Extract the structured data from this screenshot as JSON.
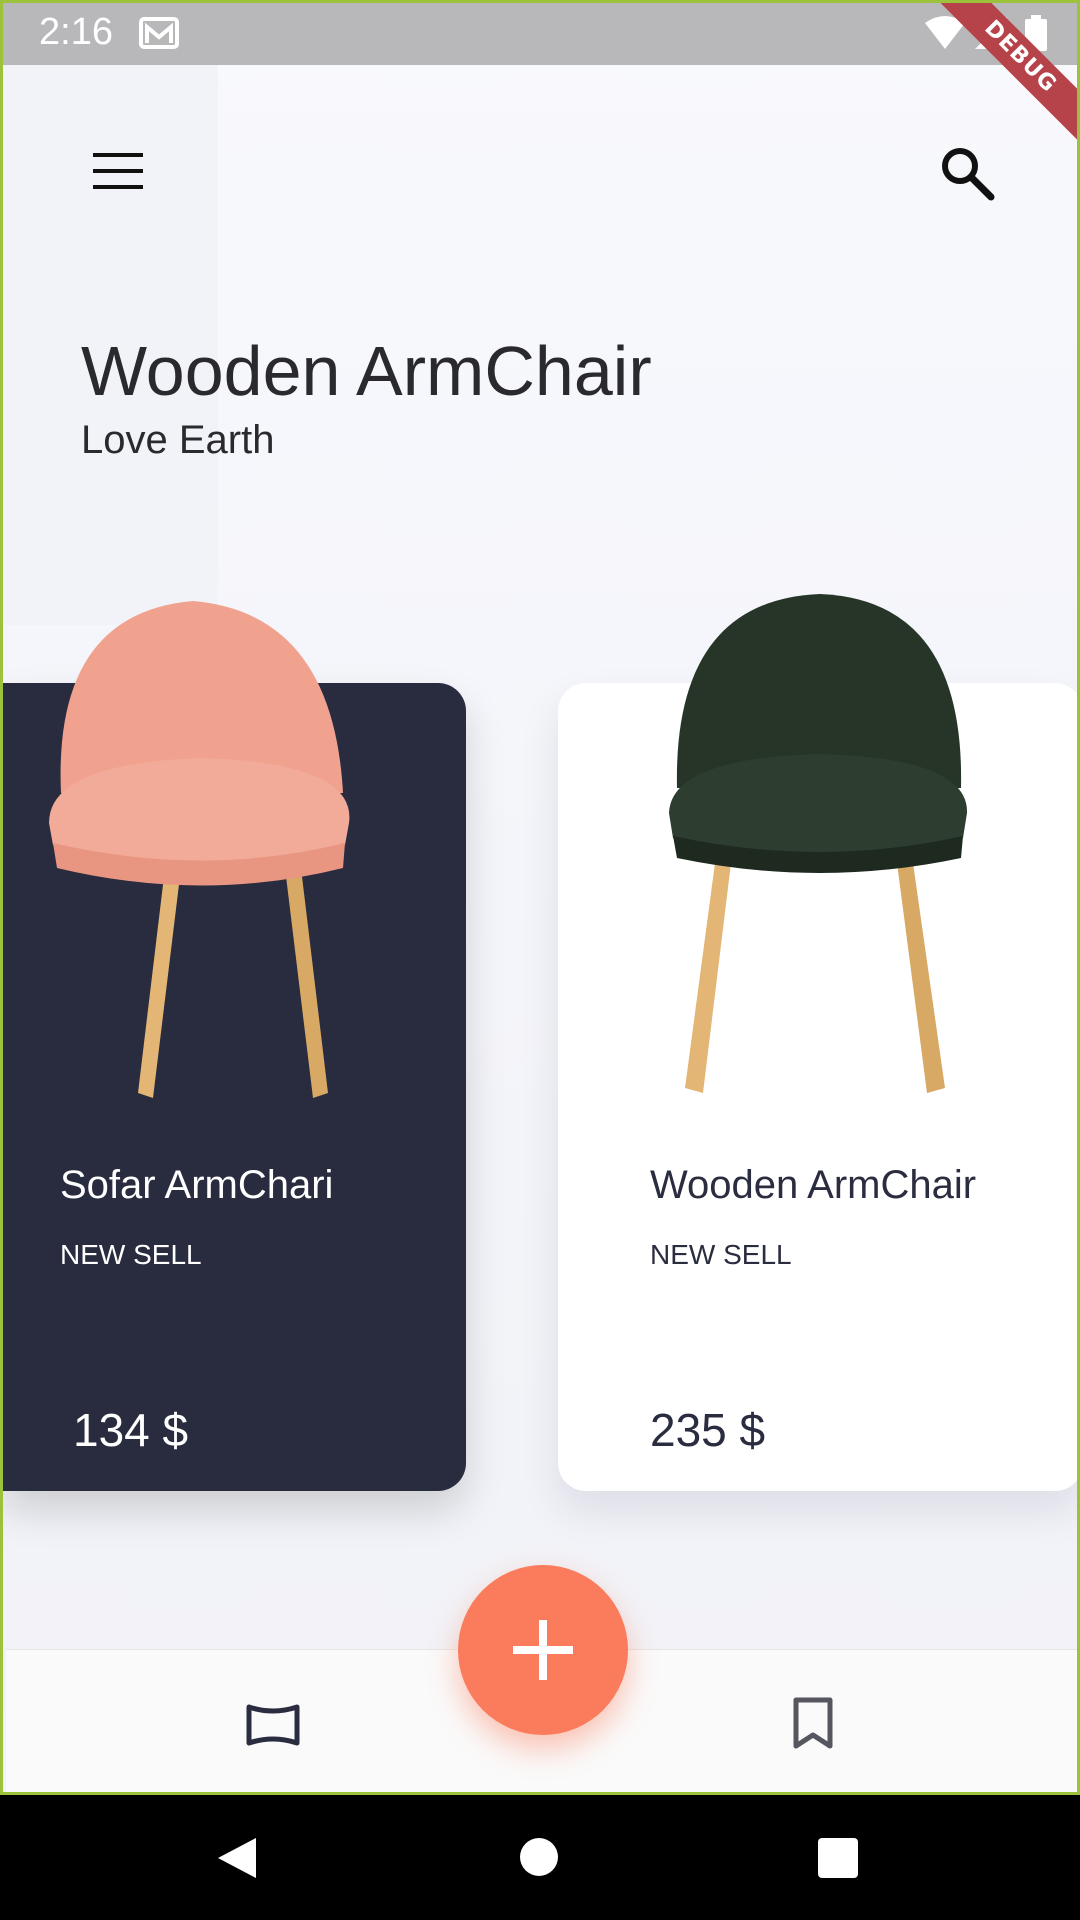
{
  "status_bar": {
    "time": "2:16",
    "debug_label": "DEBUG"
  },
  "header": {
    "menu_icon": "menu-icon",
    "search_icon": "search-icon"
  },
  "hero": {
    "title": "Wooden ArmChair",
    "subtitle": "Love Earth"
  },
  "products": [
    {
      "name": "Sofar ArmChari",
      "tag": "NEW SELL",
      "price": "134 $",
      "chair_color": "#f0a28f",
      "card_color": "#292b3f"
    },
    {
      "name": "Wooden ArmChair",
      "tag": "NEW SELL",
      "price": "235 $",
      "chair_color": "#263528",
      "card_color": "#ffffff"
    }
  ],
  "fab": {
    "icon": "plus-icon",
    "color": "#fb7c5c"
  },
  "bottom_nav": [
    {
      "icon": "panorama-icon"
    },
    {
      "icon": "bookmark-icon"
    }
  ],
  "system_nav": [
    "back-icon",
    "home-icon",
    "recent-apps-icon"
  ]
}
